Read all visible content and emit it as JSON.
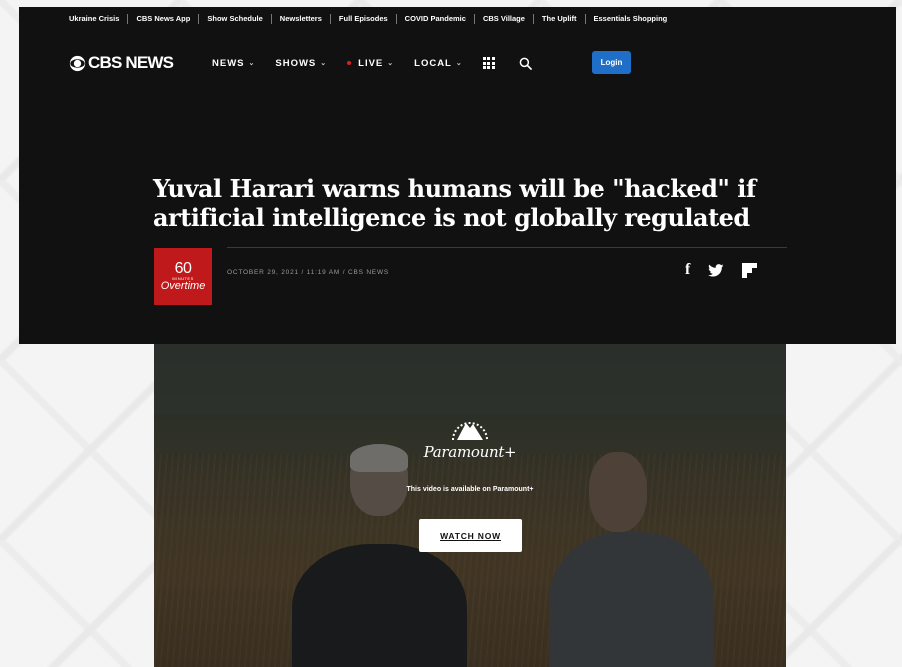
{
  "topnav": {
    "items": [
      {
        "label": "Ukraine Crisis"
      },
      {
        "label": "CBS News App"
      },
      {
        "label": "Show Schedule"
      },
      {
        "label": "Newsletters"
      },
      {
        "label": "Full Episodes"
      },
      {
        "label": "COVID Pandemic"
      },
      {
        "label": "CBS Village"
      },
      {
        "label": "The Uplift"
      },
      {
        "label": "Essentials Shopping"
      }
    ]
  },
  "header": {
    "logo_text": "CBS NEWS",
    "nav": {
      "news": "NEWS",
      "shows": "SHOWS",
      "live": "LIVE",
      "local": "LOCAL"
    },
    "login_label": "Login",
    "live_dot_color": "#e21d1d",
    "login_color": "#1f6fc8"
  },
  "article": {
    "title": "Yuval Harari warns humans will be \"hacked\" if artificial intelligence is not globally regulated",
    "byline": "OCTOBER 29, 2021 / 11:19 AM / CBS NEWS",
    "show_logo": {
      "number": "60",
      "minutes": "MINUTES",
      "overtime": "Overtime"
    },
    "social": [
      "facebook-icon",
      "twitter-icon",
      "flipboard-icon"
    ]
  },
  "video": {
    "brand": "Paramount+",
    "availability": "This video is available on Paramount+",
    "watch_label": "WATCH NOW"
  }
}
